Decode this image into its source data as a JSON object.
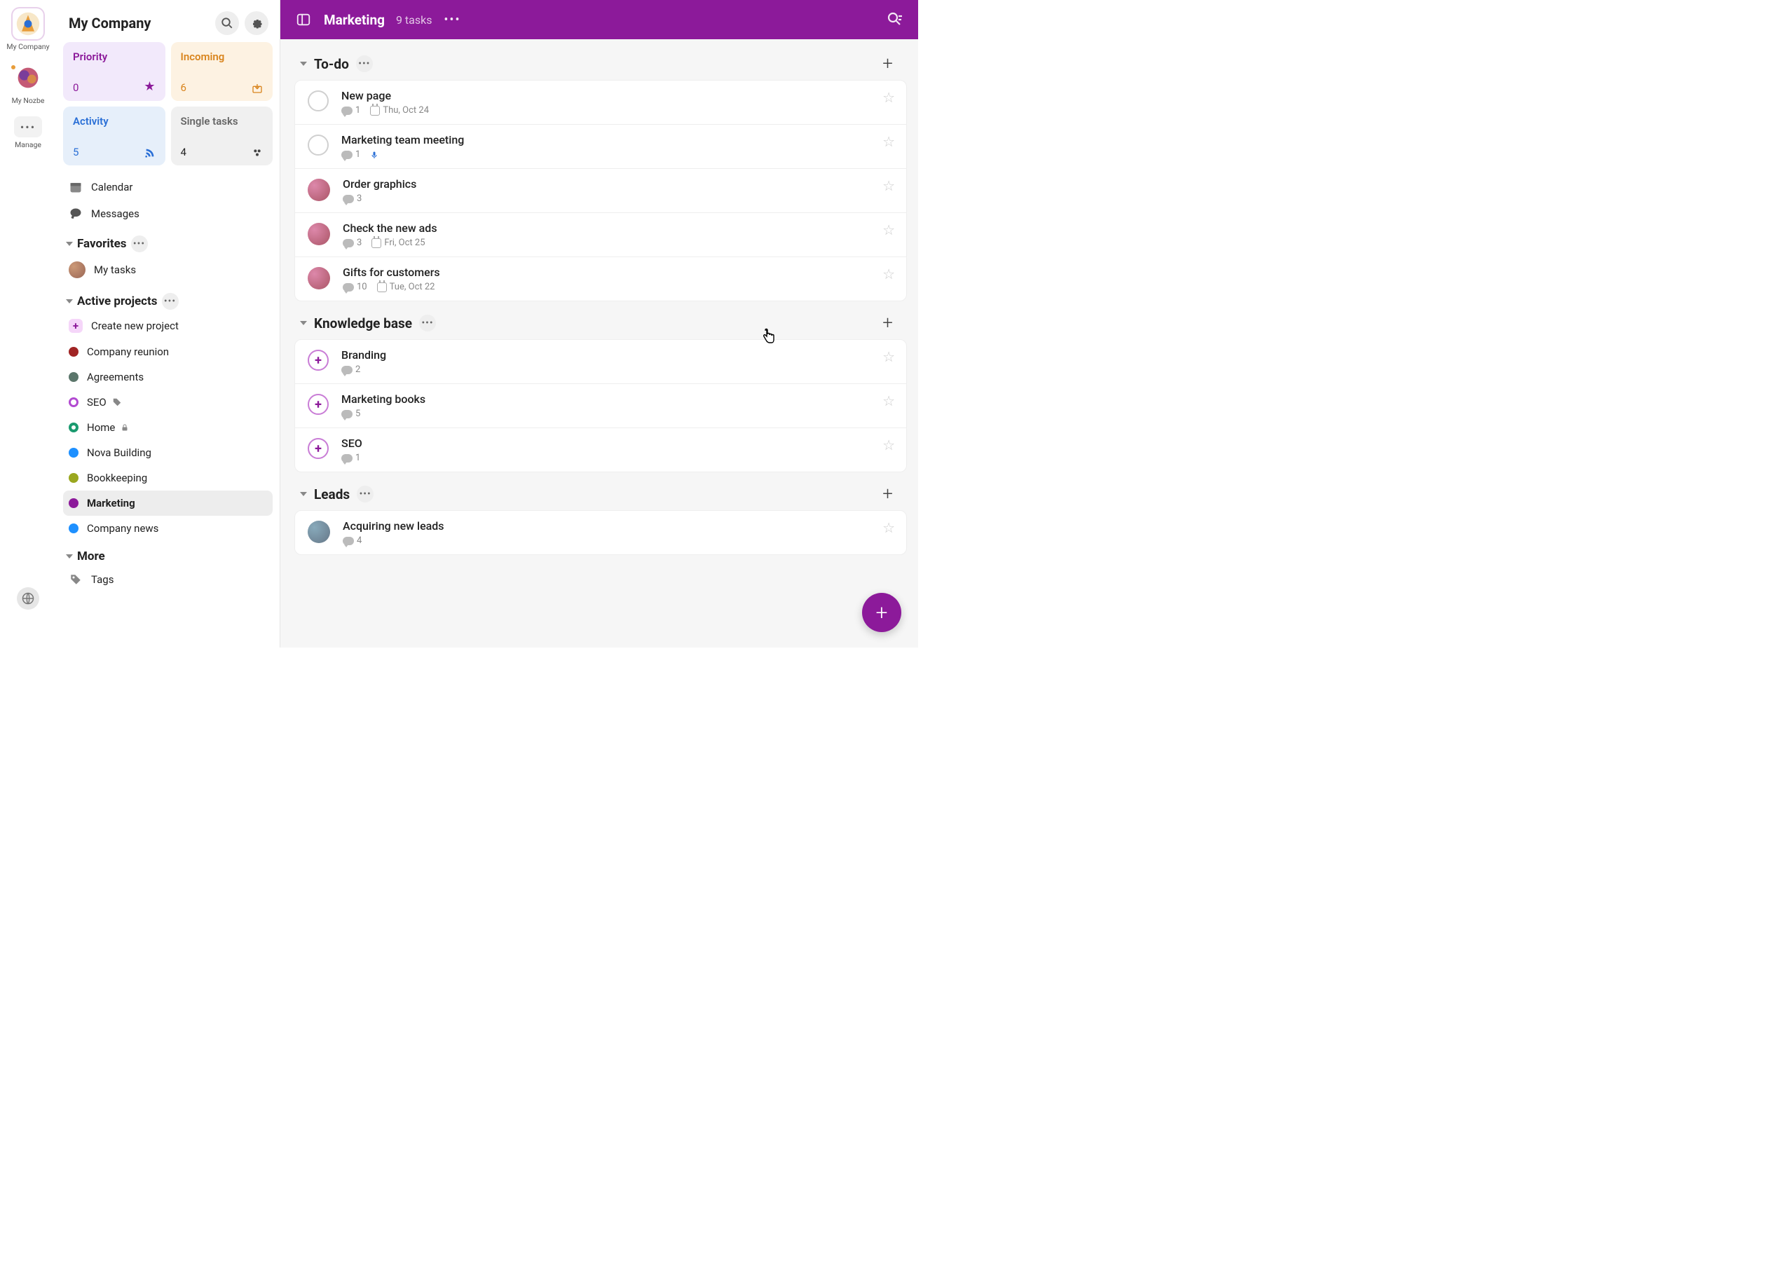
{
  "rail": {
    "items": [
      {
        "label": "My Company"
      },
      {
        "label": "My Nozbe"
      },
      {
        "label": "Manage"
      }
    ]
  },
  "sidebar": {
    "title": "My Company",
    "smartviews": {
      "priority": {
        "title": "Priority",
        "count": "0"
      },
      "incoming": {
        "title": "Incoming",
        "count": "6"
      },
      "activity": {
        "title": "Activity",
        "count": "5"
      },
      "single": {
        "title": "Single tasks",
        "count": "4"
      }
    },
    "calendar_label": "Calendar",
    "messages_label": "Messages",
    "favorites_label": "Favorites",
    "my_tasks_label": "My tasks",
    "active_projects_label": "Active projects",
    "create_project_label": "Create new project",
    "projects": [
      {
        "name": "Company reunion",
        "color": "#a02424"
      },
      {
        "name": "Agreements",
        "color": "#5b766b"
      },
      {
        "name": "SEO",
        "color": "#b24ad1",
        "badge": "tag"
      },
      {
        "name": "Home",
        "color": "#1a9a6f",
        "badge": "lock",
        "ring": true
      },
      {
        "name": "Nova Building",
        "color": "#1e90ff"
      },
      {
        "name": "Bookkeeping",
        "color": "#9aa71f"
      },
      {
        "name": "Marketing",
        "color": "#8c1a9a",
        "active": true
      },
      {
        "name": "Company news",
        "color": "#1e90ff"
      }
    ],
    "more_label": "More",
    "tags_label": "Tags"
  },
  "topbar": {
    "title": "Marketing",
    "task_count": "9 tasks"
  },
  "groups": [
    {
      "title": "To-do",
      "tasks": [
        {
          "title": "New page",
          "assignee": "none",
          "comments": "1",
          "date": "Thu, Oct 24"
        },
        {
          "title": "Marketing team meeting",
          "assignee": "none",
          "comments": "1",
          "mic": true
        },
        {
          "title": "Order graphics",
          "assignee": "avatar-a2",
          "comments": "3"
        },
        {
          "title": "Check the new ads",
          "assignee": "avatar-a2",
          "comments": "3",
          "date": "Fri, Oct 25"
        },
        {
          "title": "Gifts for customers",
          "assignee": "avatar-a2",
          "comments": "10",
          "date": "Tue, Oct 22"
        }
      ]
    },
    {
      "title": "Knowledge base",
      "tasks": [
        {
          "title": "Branding",
          "assignee": "plus",
          "comments": "2"
        },
        {
          "title": "Marketing books",
          "assignee": "plus",
          "comments": "5"
        },
        {
          "title": "SEO",
          "assignee": "plus",
          "comments": "1"
        }
      ]
    },
    {
      "title": "Leads",
      "tasks": [
        {
          "title": "Acquiring new leads",
          "assignee": "avatar-a3",
          "comments": "4"
        }
      ]
    }
  ]
}
